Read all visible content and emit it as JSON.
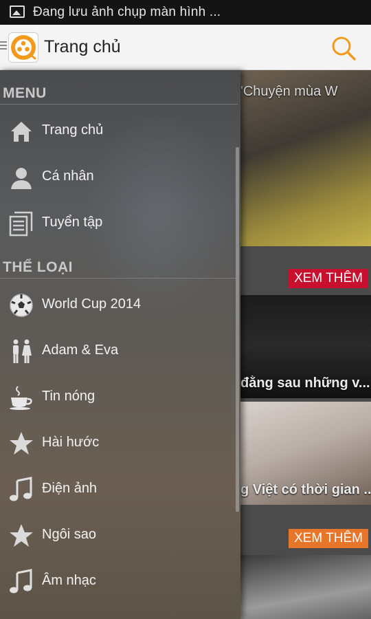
{
  "status_bar": {
    "notification": "Đang lưu ảnh chụp màn hình ..."
  },
  "action_bar": {
    "title": "Trang chủ"
  },
  "drawer": {
    "menu_header": "MENU",
    "menu_items": [
      {
        "label": "Trang chủ",
        "icon": "home-icon"
      },
      {
        "label": "Cá nhân",
        "icon": "person-icon"
      },
      {
        "label": "Tuyển tập",
        "icon": "collection-icon"
      }
    ],
    "category_header": "THỂ LOẠI",
    "category_items": [
      {
        "label": "World Cup 2014",
        "icon": "soccer-ball-icon"
      },
      {
        "label": "Adam & Eva",
        "icon": "couple-icon"
      },
      {
        "label": "Tin nóng",
        "icon": "hot-cup-icon"
      },
      {
        "label": "Hài hước",
        "icon": "star-icon"
      },
      {
        "label": "Điện ảnh",
        "icon": "music-note-icon"
      },
      {
        "label": "Ngôi sao",
        "icon": "star-icon"
      },
      {
        "label": "Âm nhạc",
        "icon": "music-note-icon"
      }
    ]
  },
  "content": {
    "card1_caption": "'Chuyện mùa W",
    "xem_them_1": "XEM THÊM",
    "card2_caption": "đằng sau những v...",
    "card3_caption": "g Việt có thời gian ...",
    "xem_them_2": "XEM THÊM"
  },
  "colors": {
    "accent": "#f29a1c",
    "xem_red": "#c8102e",
    "xem_orange": "#e7752a"
  }
}
